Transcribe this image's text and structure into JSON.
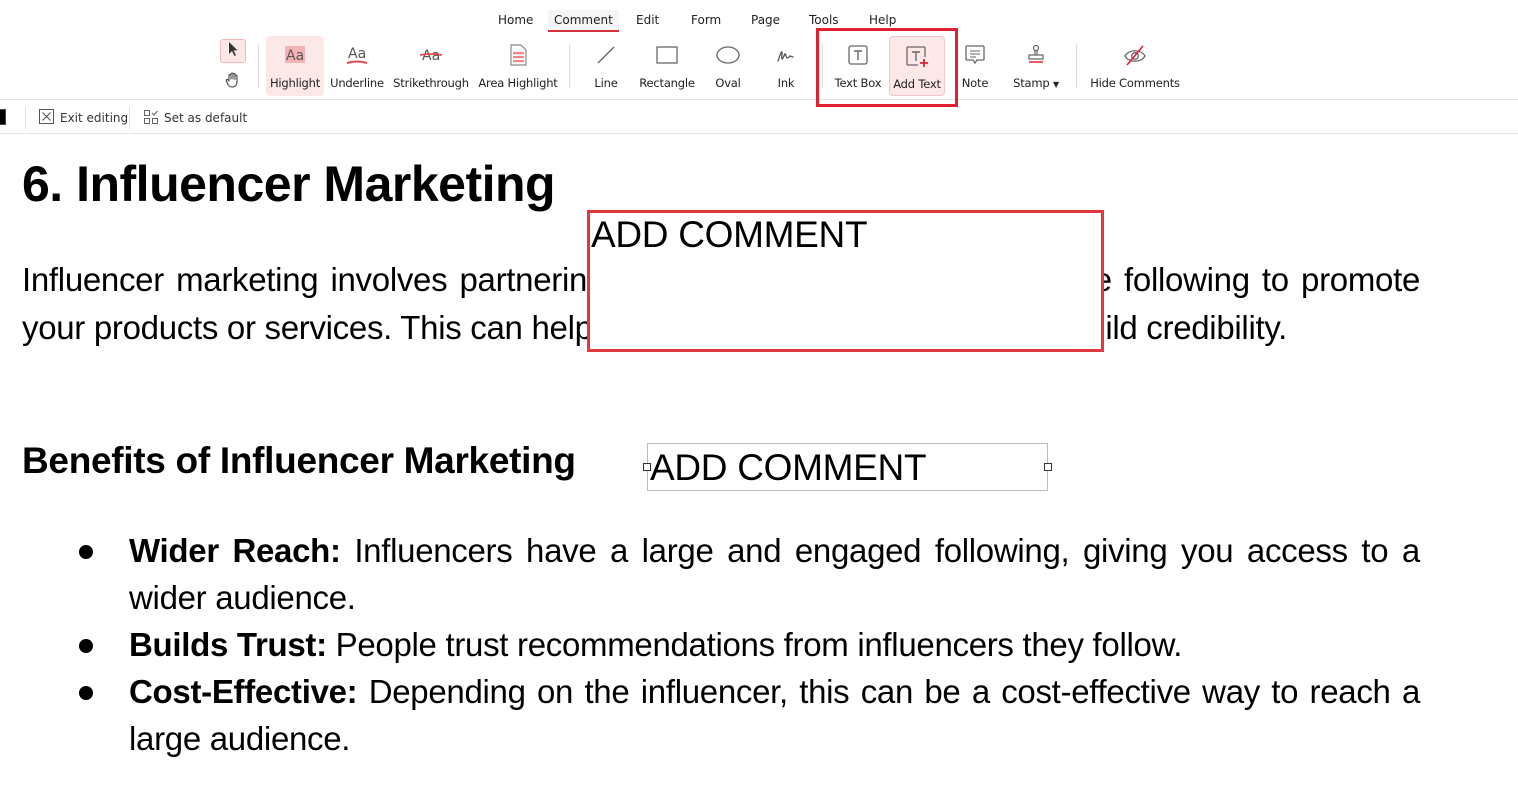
{
  "menu": {
    "tabs": [
      {
        "label": "Home"
      },
      {
        "label": "Comment",
        "active": true
      },
      {
        "label": "Edit"
      },
      {
        "label": "Form"
      },
      {
        "label": "Page"
      },
      {
        "label": "Tools"
      },
      {
        "label": "Help"
      }
    ]
  },
  "ribbon": {
    "select_tool": "select-pointer-icon",
    "hand_tool": "hand-icon",
    "tools": [
      {
        "label": "Highlight",
        "icon": "highlight-icon",
        "active": true
      },
      {
        "label": "Underline",
        "icon": "underline-icon"
      },
      {
        "label": "Strikethrough",
        "icon": "strikethrough-icon"
      },
      {
        "label": "Area Highlight",
        "icon": "area-highlight-icon"
      },
      {
        "label": "Line",
        "icon": "line-icon"
      },
      {
        "label": "Rectangle",
        "icon": "rectangle-icon"
      },
      {
        "label": "Oval",
        "icon": "oval-icon"
      },
      {
        "label": "Ink",
        "icon": "ink-icon"
      },
      {
        "label": "Text Box",
        "icon": "text-box-icon"
      },
      {
        "label": "Add Text",
        "icon": "add-text-icon",
        "active": true
      },
      {
        "label": "Note",
        "icon": "note-icon"
      },
      {
        "label": "Stamp",
        "icon": "stamp-icon",
        "dropdown": true
      },
      {
        "label": "Hide Comments",
        "icon": "hide-comments-icon"
      }
    ]
  },
  "subbar": {
    "exit_editing": "Exit editing",
    "set_as_default": "Set as default",
    "current_color": "#000000"
  },
  "document": {
    "heading": "6. Influencer Marketing",
    "paragraph": "Influencer marketing involves partnering with influencers who have a large following to promote your products or services. This can help you reach a wider audience and build credibility.",
    "subheading": "Benefits of Influencer Marketing",
    "bullets": [
      {
        "title": "Wider Reach:",
        "text": " Influencers have a large and engaged following, giving you access to a wider audience."
      },
      {
        "title": "Builds Trust:",
        "text": " People trust recommendations from influencers they follow."
      },
      {
        "title": "Cost-Effective:",
        "text": " Depending on the influencer, this can be a cost-effective way to reach a large audience."
      }
    ]
  },
  "annotations": [
    {
      "text": "ADD COMMENT",
      "border_color": "#e03a3e"
    },
    {
      "text": "ADD COMMENT",
      "border_color": "#bdbdbd",
      "selected": true
    }
  ],
  "colors": {
    "accent": "#d6313a",
    "active_bg": "#fde8e8",
    "highlight_frame": "#e02030"
  }
}
